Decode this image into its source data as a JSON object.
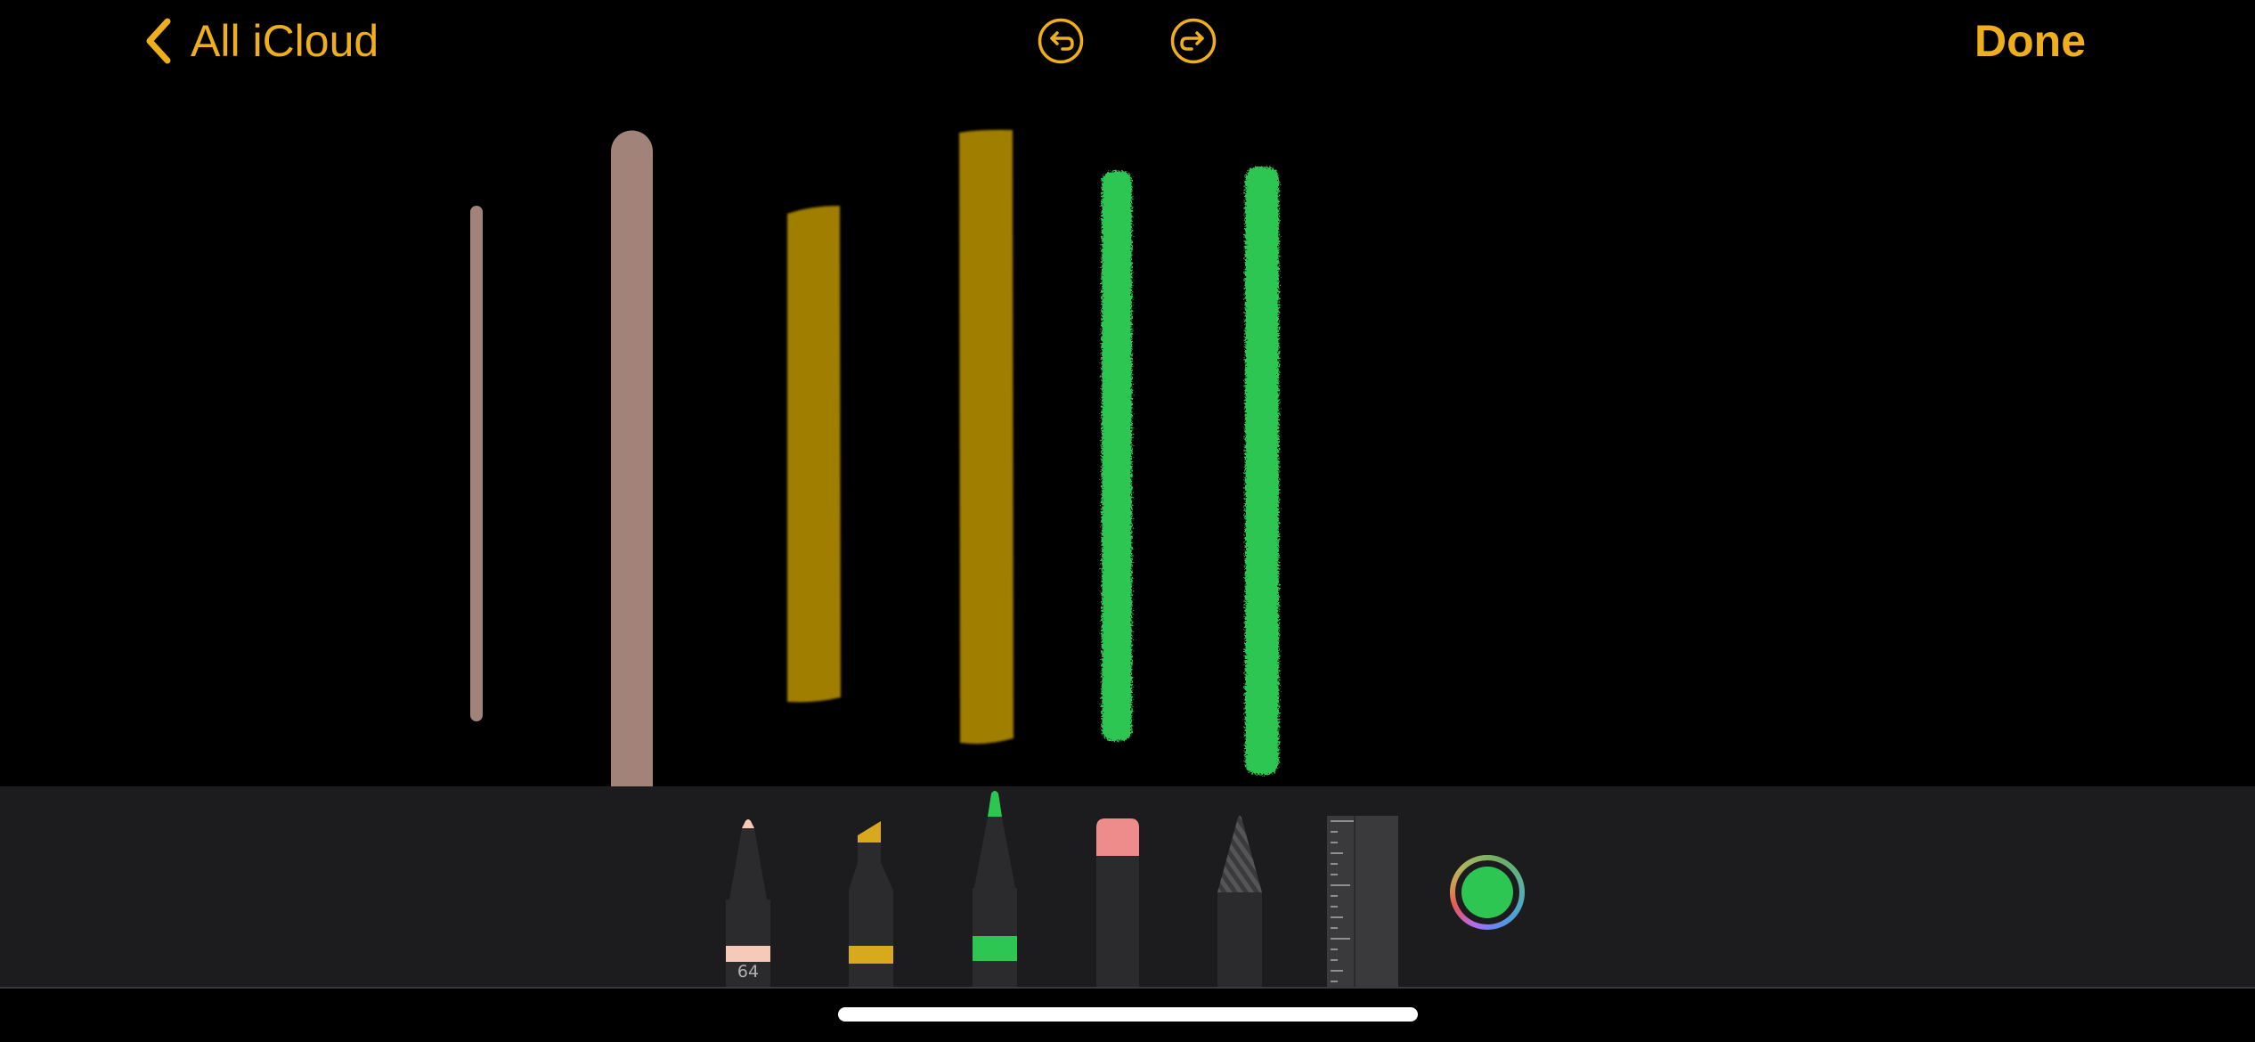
{
  "colors": {
    "accent": "#EFAF1B",
    "toolbar_background": "#1C1C1E",
    "canvas_background": "#000000",
    "current_color": "#2DC653"
  },
  "nav": {
    "back_label": "All iCloud",
    "back_icon": "chevron-left-icon",
    "undo_icon": "undo-icon",
    "redo_icon": "redo-icon",
    "done_label": "Done"
  },
  "strokes": [
    {
      "tool": "pen",
      "color": "#A1837A",
      "size": "thin"
    },
    {
      "tool": "pen",
      "color": "#A1837A",
      "size": "thick"
    },
    {
      "tool": "marker",
      "color": "#A88500",
      "size": "thin"
    },
    {
      "tool": "marker",
      "color": "#A88500",
      "size": "thick"
    },
    {
      "tool": "pencil",
      "color": "#2DC653",
      "size": "thin"
    },
    {
      "tool": "pencil",
      "color": "#2DC653",
      "size": "thick"
    }
  ],
  "tools": [
    {
      "name": "pen",
      "color": "#F7C9B8",
      "size_label": "64",
      "selected": false
    },
    {
      "name": "marker",
      "color": "#D8A91D",
      "selected": false
    },
    {
      "name": "pencil",
      "color": "#2DC653",
      "selected": true
    },
    {
      "name": "eraser",
      "color": "#EE8C8C",
      "selected": false
    },
    {
      "name": "lasso",
      "selected": false
    },
    {
      "name": "ruler",
      "selected": false
    }
  ],
  "color_picker": {
    "current": "#2DC653",
    "icon": "color-picker-icon"
  }
}
